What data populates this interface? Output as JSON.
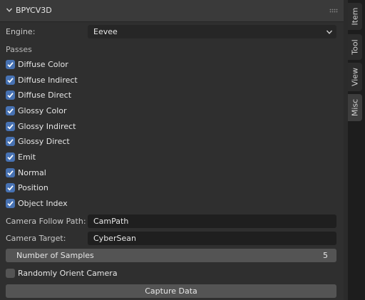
{
  "panel": {
    "title": "BPYCV3D",
    "engine_label": "Engine:",
    "engine_value": "Eevee",
    "passes_label": "Passes",
    "passes": [
      {
        "label": "Diffuse Color",
        "checked": true
      },
      {
        "label": "Diffuse Indirect",
        "checked": true
      },
      {
        "label": "Diffuse Direct",
        "checked": true
      },
      {
        "label": "Glossy Color",
        "checked": true
      },
      {
        "label": "Glossy Indirect",
        "checked": true
      },
      {
        "label": "Glossy Direct",
        "checked": true
      },
      {
        "label": "Emit",
        "checked": true
      },
      {
        "label": "Normal",
        "checked": true
      },
      {
        "label": "Position",
        "checked": true
      },
      {
        "label": "Object Index",
        "checked": true
      }
    ],
    "camera_follow_path_label": "Camera Follow Path:",
    "camera_follow_path_value": "CamPath",
    "camera_target_label": "Camera Target:",
    "camera_target_value": "CyberSean",
    "samples_label": "Number of Samples",
    "samples_value": "5",
    "randomly_orient_label": "Randomly Orient Camera",
    "randomly_orient_checked": false,
    "capture_button": "Capture Data"
  },
  "tabs": [
    {
      "label": "Item",
      "active": false
    },
    {
      "label": "Tool",
      "active": false
    },
    {
      "label": "View",
      "active": false
    },
    {
      "label": "Misc",
      "active": true
    }
  ],
  "colors": {
    "accent": "#4772b3",
    "panel_bg": "#2f2f2f",
    "field_bg": "#1f1f1f"
  }
}
